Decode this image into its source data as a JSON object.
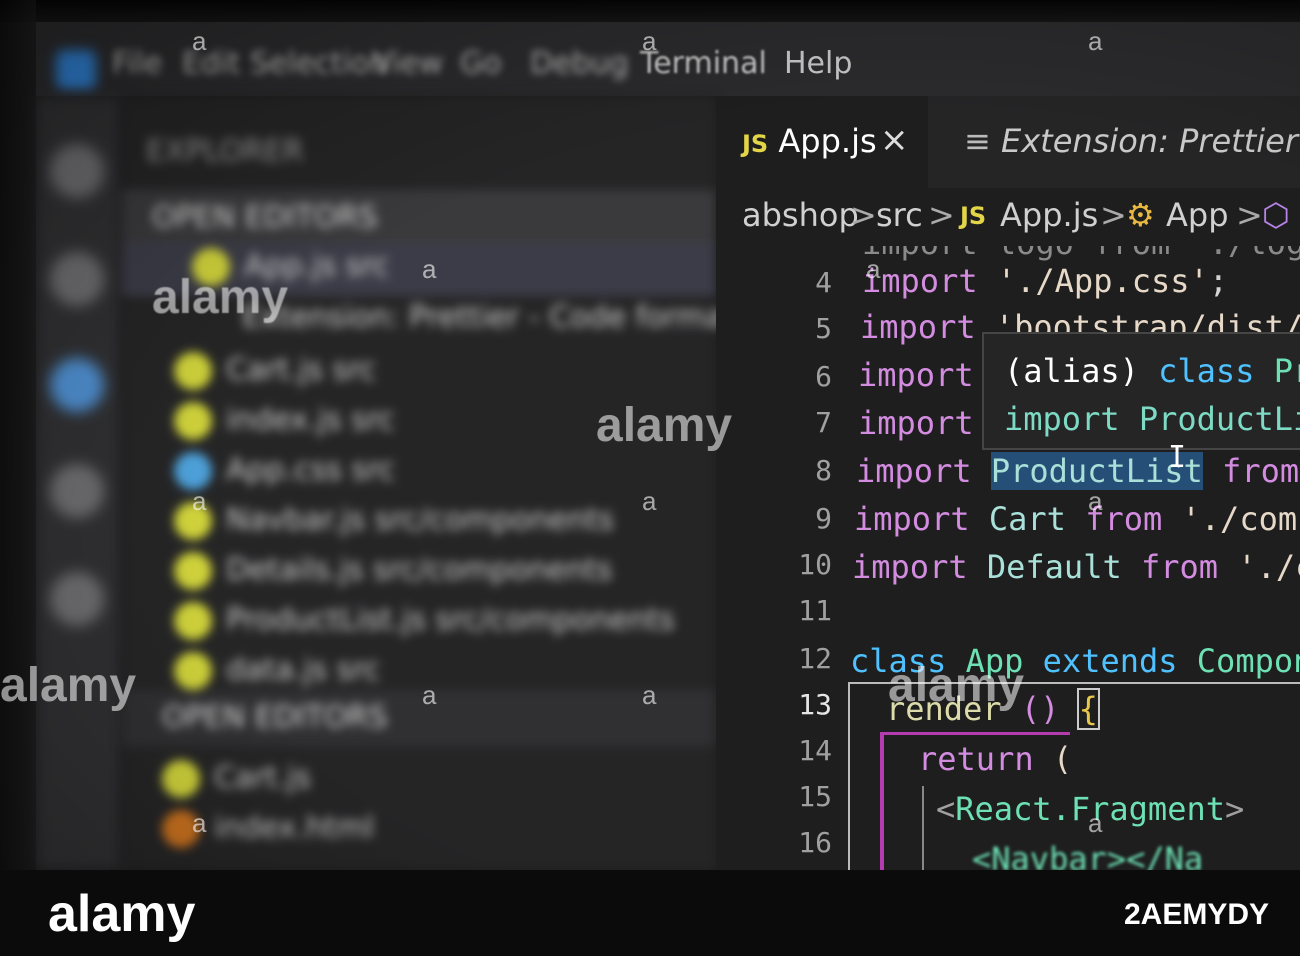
{
  "menu": {
    "items_blurred": [
      "File",
      "Edit",
      "Selection",
      "View",
      "Go",
      "Debug"
    ],
    "terminal": "Terminal",
    "help": "Help"
  },
  "explorer": {
    "header": "EXPLORER",
    "open_editors": "OPEN EDITORS",
    "open_items": [
      "App.js src",
      "Extension: Prettier - Code formatter",
      "Cart.js src",
      "index.js src",
      "App.css src",
      "Navbar.js src/components",
      "Details.js src/components",
      "ProductList.js src/components",
      "data.js src"
    ],
    "second_section": "OPEN EDITORS",
    "folder_items": [
      "Cart.js",
      "index.html"
    ]
  },
  "tabs": [
    {
      "badge": "JS",
      "label": "App.js",
      "close": "×",
      "active": true
    },
    {
      "icon": "≡",
      "label": "Extension: Prettier - Co",
      "active": false
    }
  ],
  "breadcrumb": {
    "root": "abshop",
    "folder": "src",
    "file_badge": "JS",
    "file": "App.js",
    "class_icon": "⚙",
    "class": "App",
    "cube_icon": "⬡",
    "sep": ">"
  },
  "code": {
    "line_numbers": [
      "4",
      "5",
      "6",
      "7",
      "8",
      "9",
      "10",
      "11",
      "12",
      "13",
      "14",
      "15",
      "16"
    ],
    "active_line": "13",
    "partial_top": "import logo from './logo",
    "l4": {
      "kw": "import",
      "str": "'./App.css'",
      "end": ";"
    },
    "l5": {
      "kw": "import",
      "str": "'bootstrap/dist/c"
    },
    "l6": {
      "kw": "import"
    },
    "l7": {
      "kw": "import"
    },
    "l8": {
      "kw": "import",
      "id": "ProductList",
      "from": "from"
    },
    "l9": {
      "kw": "import",
      "id": "Cart",
      "from": "from",
      "str": "'./compo"
    },
    "l10": {
      "kw": "import",
      "id": "Default",
      "from": "from",
      "str": "'./co"
    },
    "l12": {
      "kw": "class",
      "id": "App",
      "ext": "extends",
      "comp": "Compone"
    },
    "l13": {
      "fn": "render",
      "paren": "()",
      "brace": "{"
    },
    "l14": {
      "kw": "return",
      "paren": "("
    },
    "l15": {
      "open": "<",
      "tag": "React.Fragment",
      "close": ">"
    },
    "l16": {
      "tag": "<Navbar></Na"
    }
  },
  "hover": {
    "line1_a": "(alias)",
    "line1_b": "class",
    "line1_c": "Pr",
    "line2": "import ProductLi"
  },
  "watermarks": {
    "text": "alamy",
    "plus": "a",
    "brand": "alamy",
    "image_id": "2AEMYDY"
  },
  "colors": {
    "keyword": "#d38ce0",
    "identifier": "#a9e0d8",
    "class_kw": "#4fc1ff",
    "component": "#6de0b4",
    "js_badge": "#e2d548"
  }
}
